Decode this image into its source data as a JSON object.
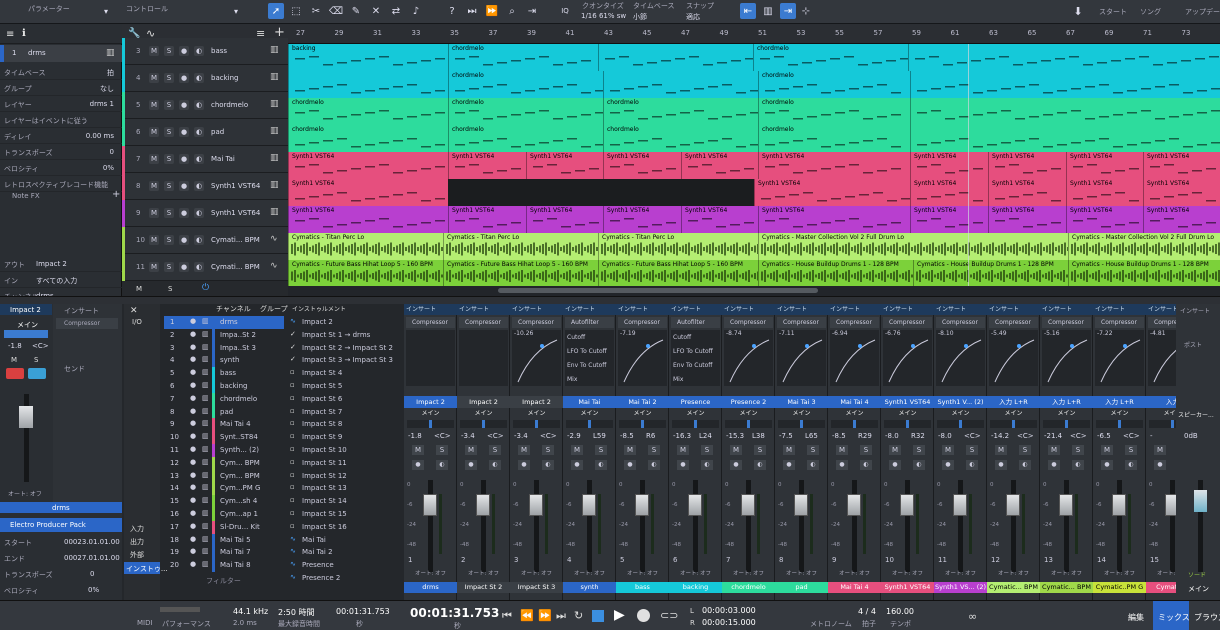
{
  "topbar": {
    "tab1": "パラメーター",
    "tab2": "コントロール",
    "quantize_label": "クオンタイズ",
    "quantize_value": "1/16 61% sw",
    "timebase_label": "タイムベース",
    "timebase_value": "小節",
    "snap_label": "スナップ",
    "snap_value": "適応",
    "start": "スタート",
    "song": "ソング",
    "update": "アップデー"
  },
  "inspector": {
    "track_num": "1",
    "track_name": "drms",
    "rows": [
      {
        "label": "タイムベース",
        "value": "拍"
      },
      {
        "label": "グループ",
        "value": "なし"
      },
      {
        "label": "レイヤー",
        "value": "drms 1"
      },
      {
        "label": "レイヤーはイベントに従う",
        "value": ""
      },
      {
        "label": "ディレイ",
        "value": "0.00 ms"
      },
      {
        "label": "トランスポーズ",
        "value": "0"
      },
      {
        "label": "ベロシティ",
        "value": "0%"
      },
      {
        "label": "レトロスペクティブレコード機能",
        "value": ""
      }
    ],
    "note_fx": "Note FX",
    "out_label": "アウト",
    "out_value": "Impact 2",
    "in_label": "イン",
    "in_value": "すべての入力",
    "ch_label": "チャンネル",
    "ch_value": "drms",
    "pack": "Electro Producer Pack",
    "start_label": "スタート",
    "start_value": "00023.01.01.00",
    "end_label": "エンド",
    "end_value": "00027.01.01.00",
    "trans_label": "トランスポーズ",
    "trans_value": "0",
    "vel_label": "ベロシティ",
    "vel_value": "0%",
    "ch_name": "Impact 2",
    "ch_sub": "メイン",
    "ch_vol": "-1.8",
    "ch_pan": "<C>",
    "insert": "インサート",
    "comp": "Compressor",
    "send": "センド",
    "auto": "オート: オフ",
    "ch_bottom": "drms"
  },
  "tracks": [
    {
      "num": "3",
      "name": "bass"
    },
    {
      "num": "4",
      "name": "backing"
    },
    {
      "num": "5",
      "name": "chordmelo"
    },
    {
      "num": "6",
      "name": "pad"
    },
    {
      "num": "7",
      "name": "Mai Tai"
    },
    {
      "num": "8",
      "name": "Synth1 VST64"
    },
    {
      "num": "9",
      "name": "Synth1 VST64"
    },
    {
      "num": "10",
      "name": "Cymati... BPM"
    },
    {
      "num": "11",
      "name": "Cymati... BPM"
    }
  ],
  "ruler": [
    "27",
    "29",
    "31",
    "33",
    "35",
    "37",
    "39",
    "41",
    "43",
    "45",
    "47",
    "49",
    "51",
    "53",
    "55",
    "57",
    "59",
    "61",
    "63",
    "65",
    "67",
    "69",
    "71",
    "73"
  ],
  "clip_labels": {
    "backing": "backing",
    "chordmelo": "chordmelo",
    "synth": "Synth1 VST64",
    "cym1": "Cymatics - Titan Perc Lo",
    "cym1b": "Cymatics - Master Collection Vol 2 Full Drum Lo",
    "cym2": "Cymatics - Future Bass Hihat Loop 5 - 160 BPM",
    "cym2b": "Cymatics - House Buildup Drums 1 - 128 BPM"
  },
  "browser": {
    "ch_header": "チャンネル",
    "grp_header": "グループ",
    "inst_header": "インストゥルメント",
    "io": "I/O",
    "input": "入力",
    "output": "出力",
    "ext": "外部",
    "inst": "インストゥ...",
    "filter": "フィルター",
    "channels": [
      "drms",
      "Impa..St 2",
      "Impa..St 3",
      "synth",
      "bass",
      "backing",
      "chordmelo",
      "pad",
      "Mai Tai 4",
      "Synt..ST84",
      "Synth... (2)",
      "Cym... BPM",
      "Cym... BPM",
      "Cym...PM G",
      "Cym...sh 4",
      "Cym...ap 1",
      "Sl-Dru... Kit",
      "Mai Tai 5",
      "Mai Tai 7",
      "Mai Tai 8"
    ],
    "instruments": [
      "Impact 2",
      "Impact St 1 → drms",
      "Impact St 2 → Impact St 2",
      "Impact St 3 → Impact St 3",
      "Impact St 4",
      "Impact St 5",
      "Impact St 6",
      "Impact St 7",
      "Impact St 8",
      "Impact St 9",
      "Impact St 10",
      "Impact St 11",
      "Impact St 12",
      "Impact St 13",
      "Impact St 14",
      "Impact St 15",
      "Impact St 16",
      "Mai Tai",
      "Mai Tai 2",
      "Presence",
      "Presence 2"
    ]
  },
  "strips": [
    {
      "slot": "Compressor",
      "name": "Impact 2",
      "sub": "メイン",
      "vol": "-1.8",
      "pan": "<C>",
      "num": "1",
      "bottom": "drms"
    },
    {
      "slot": "Compressor",
      "name": "Impact 2",
      "sub": "メイン",
      "vol": "-3.4",
      "pan": "<C>",
      "num": "2",
      "bottom": "Impact St 2"
    },
    {
      "slot": "Compressor",
      "name": "Impact 2",
      "sub": "メイン",
      "vol": "-3.4",
      "pan": "<C>",
      "num": "3",
      "bottom": "Impact St 3"
    },
    {
      "slot": "Autofilter",
      "name": "Mai Tai",
      "sub": "メイン",
      "vol": "-2.9",
      "pan": "L59",
      "num": "4",
      "bottom": "synth"
    },
    {
      "slot": "Compressor",
      "name": "Mai Tai 2",
      "sub": "メイン",
      "vol": "-8.5",
      "pan": "R6",
      "num": "5",
      "bottom": "bass"
    },
    {
      "slot": "Autofilter",
      "name": "Presence",
      "sub": "メイン",
      "vol": "-16.3",
      "pan": "L24",
      "num": "6",
      "bottom": "backing"
    },
    {
      "slot": "Compressor",
      "name": "Presence 2",
      "sub": "メイン",
      "vol": "-15.3",
      "pan": "L38",
      "num": "7",
      "bottom": "chordmelo"
    },
    {
      "slot": "Compressor",
      "name": "Mai Tai 3",
      "sub": "メイン",
      "vol": "-7.5",
      "pan": "L65",
      "num": "8",
      "bottom": "pad"
    },
    {
      "slot": "Compressor",
      "name": "Mai Tai 4",
      "sub": "メイン",
      "vol": "-8.5",
      "pan": "R29",
      "num": "9",
      "bottom": "Mai Tai 4"
    },
    {
      "slot": "Compressor",
      "name": "Synth1 VST64",
      "sub": "メイン",
      "vol": "-8.0",
      "pan": "R32",
      "num": "10",
      "bottom": "Synth1 VST64"
    },
    {
      "slot": "Compressor",
      "name": "Synth1 V... (2)",
      "sub": "メイン",
      "vol": "-8.0",
      "pan": "<C>",
      "num": "11",
      "bottom": "Synth1 VS... (2)"
    },
    {
      "slot": "Compressor",
      "name": "入力 L+R",
      "sub": "メイン",
      "vol": "-14.2",
      "pan": "<C>",
      "num": "12",
      "bottom": "Cymatic... BPM"
    },
    {
      "slot": "Compressor",
      "name": "入力 L+R",
      "sub": "メイン",
      "vol": "-21.4",
      "pan": "<C>",
      "num": "13",
      "bottom": "Cymatic... BPM"
    },
    {
      "slot": "Compressor",
      "name": "入力 L+R",
      "sub": "メイン",
      "vol": "-6.5",
      "pan": "<C>",
      "num": "14",
      "bottom": "Cymatic..PM G"
    },
    {
      "slot": "Compressor",
      "name": "入力",
      "sub": "メイン",
      "vol": "-",
      "pan": "",
      "num": "15",
      "bottom": "Cymatic..."
    }
  ],
  "strip_common": {
    "insert": "インサート",
    "auto": "オート: オフ",
    "m": "M",
    "s": "S"
  },
  "graph_vals": [
    "",
    "",
    "-10.26",
    "",
    "-7.19",
    "",
    "-8.74",
    "-7.11",
    "-6.94",
    "-6.76",
    "-8.10",
    "-5.49",
    "-5.16",
    "-7.22",
    "-4.81"
  ],
  "right": {
    "insert": "インサート",
    "post": "ポスト",
    "speaker": "スピーカー...",
    "db": "0dB",
    "main": "メイン",
    "solo": "ソード"
  },
  "transport": {
    "midi": "MIDI",
    "perf": "パフォーマンス",
    "rate": "44.1 kHz",
    "latency": "2.0 ms",
    "rec_time": "2:50 時間",
    "rec_label": "最大録音時間",
    "pos1": "00:01:31.753",
    "pos1_label": "秒",
    "pos2": "00:01:31.753",
    "pos2_label": "秒",
    "l_val": "00:00:03.000",
    "r_val": "00:00:15.000",
    "metro": "メトロノーム",
    "sig": "4 / 4",
    "sig_label": "拍子",
    "tempo": "160.00",
    "tempo_label": "テンポ",
    "edit": "編集",
    "mix": "ミックス",
    "browse": "ブラウズ"
  },
  "colors": {
    "cyan": "#15c9d9",
    "green": "#2ddc9d",
    "pink": "#e64f7e",
    "magenta": "#b83fcf",
    "lime": "#9fd84a",
    "blue": "#2b66c7"
  }
}
